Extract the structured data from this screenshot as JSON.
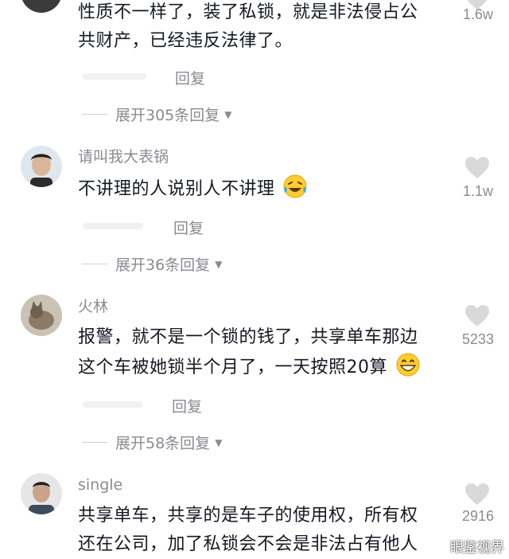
{
  "comments": [
    {
      "username": "",
      "text_lines": [
        "性质不一样了，装了私锁，就是非法侵占公",
        "共财产，已经违反法律了。"
      ],
      "likes": "1.6w",
      "reply_label": "回复",
      "expand_label": "展开305条回复"
    },
    {
      "username": "请叫我大表锅",
      "text_lines": [
        "不讲理的人说别人不讲理"
      ],
      "emoji": "laughing-tears-emoji",
      "likes": "1.1w",
      "reply_label": "回复",
      "expand_label": "展开36条回复"
    },
    {
      "username": "火林",
      "text_lines": [
        "报警，就不是一个锁的钱了，共享单车那边",
        "这个车被她锁半个月了，一天按照20算"
      ],
      "emoji": "grinning-emoji",
      "likes": "5233",
      "reply_label": "回复",
      "expand_label": "展开58条回复"
    },
    {
      "username": "single",
      "text_lines": [
        "共享单车，共享的是车子的使用权，所有权",
        "还在公司，加了私锁会不会是非法占有他人"
      ],
      "likes": "2916"
    }
  ],
  "watermark": "眼鉴视界",
  "colors": {
    "text": "#161823",
    "muted": "#8a8b91",
    "like_icon": "#d9d9d9"
  }
}
